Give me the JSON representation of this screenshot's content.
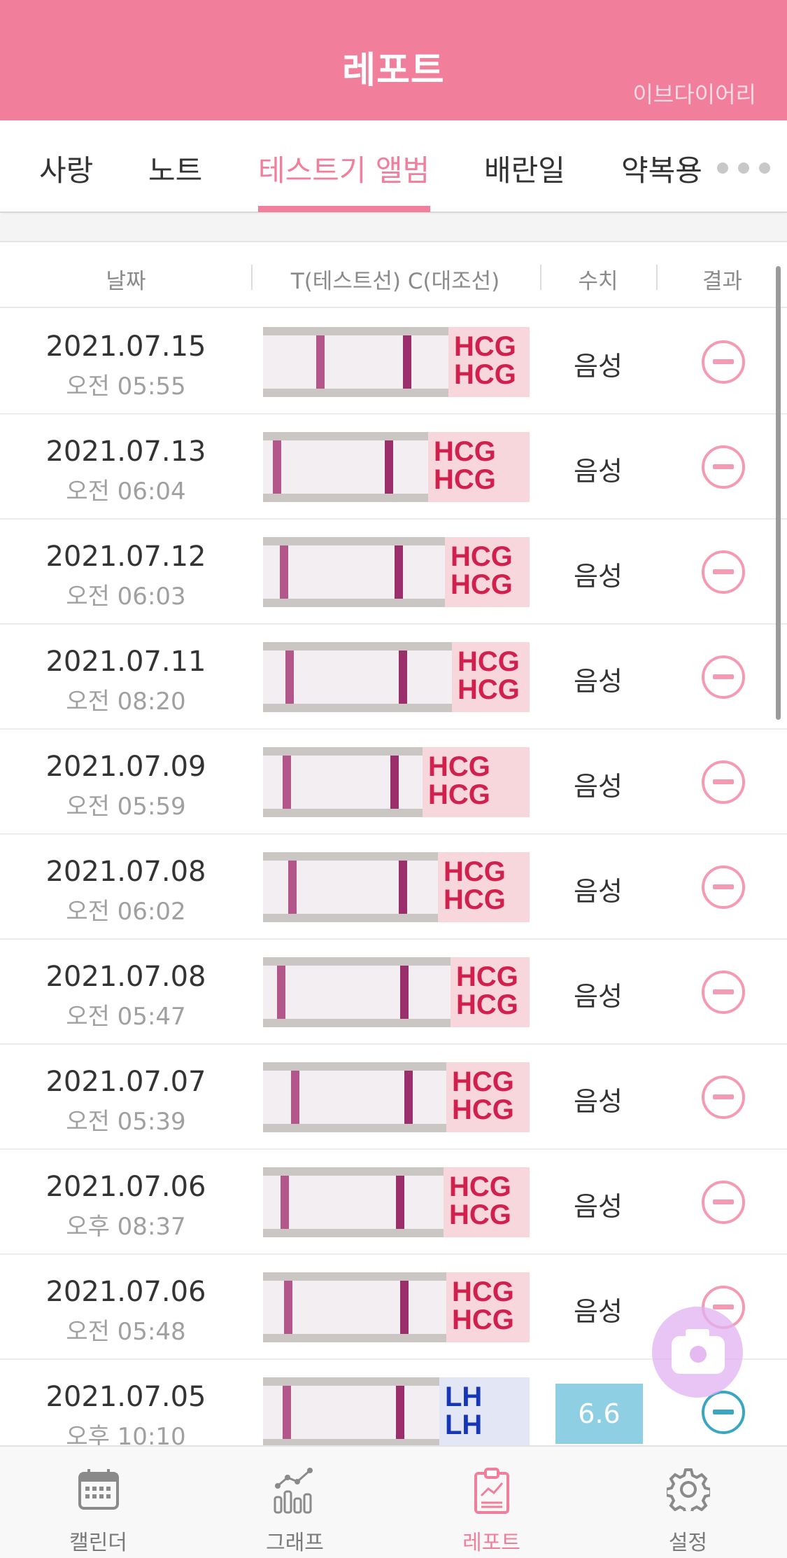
{
  "header": {
    "title": "레포트",
    "brand": "이브다이어리"
  },
  "tabs": [
    {
      "label": "사랑"
    },
    {
      "label": "노트"
    },
    {
      "label": "테스트기 앨범"
    },
    {
      "label": "배란일"
    },
    {
      "label": "약복용"
    }
  ],
  "active_tab": "테스트기 앨범",
  "columns": {
    "date": "날짜",
    "strip": "T(테스트선) C(대조선)",
    "value": "수치",
    "result": "결과"
  },
  "rows": [
    {
      "date": "2021.07.15",
      "time": "오전 05:55",
      "value": "음성",
      "kind": "HCG",
      "result": "minus-icon"
    },
    {
      "date": "2021.07.13",
      "time": "오전 06:04",
      "value": "음성",
      "kind": "HCG",
      "result": "minus-icon"
    },
    {
      "date": "2021.07.12",
      "time": "오전 06:03",
      "value": "음성",
      "kind": "HCG",
      "result": "minus-icon"
    },
    {
      "date": "2021.07.11",
      "time": "오전 08:20",
      "value": "음성",
      "kind": "HCG",
      "result": "minus-icon"
    },
    {
      "date": "2021.07.09",
      "time": "오전 05:59",
      "value": "음성",
      "kind": "HCG",
      "result": "minus-icon"
    },
    {
      "date": "2021.07.08",
      "time": "오전 06:02",
      "value": "음성",
      "kind": "HCG",
      "result": "minus-icon"
    },
    {
      "date": "2021.07.08",
      "time": "오전 05:47",
      "value": "음성",
      "kind": "HCG",
      "result": "minus-icon"
    },
    {
      "date": "2021.07.07",
      "time": "오전 05:39",
      "value": "음성",
      "kind": "HCG",
      "result": "minus-icon"
    },
    {
      "date": "2021.07.06",
      "time": "오후 08:37",
      "value": "음성",
      "kind": "HCG",
      "result": "minus-icon"
    },
    {
      "date": "2021.07.06",
      "time": "오전 05:48",
      "value": "음성",
      "kind": "HCG",
      "result": "minus-icon"
    },
    {
      "date": "2021.07.05",
      "time": "오후 10:10",
      "value": "6.6",
      "kind": "LH",
      "result": "minus-icon"
    }
  ],
  "strip_labels": {
    "hcg": "HCG\nHCG",
    "lh": "LH\nLH"
  },
  "bottom_nav": [
    {
      "label": "캘린더",
      "icon": "calendar-icon"
    },
    {
      "label": "그래프",
      "icon": "graph-icon"
    },
    {
      "label": "레포트",
      "icon": "report-icon"
    },
    {
      "label": "설정",
      "icon": "settings-icon"
    }
  ],
  "colors": {
    "accent": "#f17f9c",
    "negative_icon": "#f49ab2",
    "lh_value_bg": "#8ecfe3",
    "lh_icon": "#3aa6c0"
  }
}
